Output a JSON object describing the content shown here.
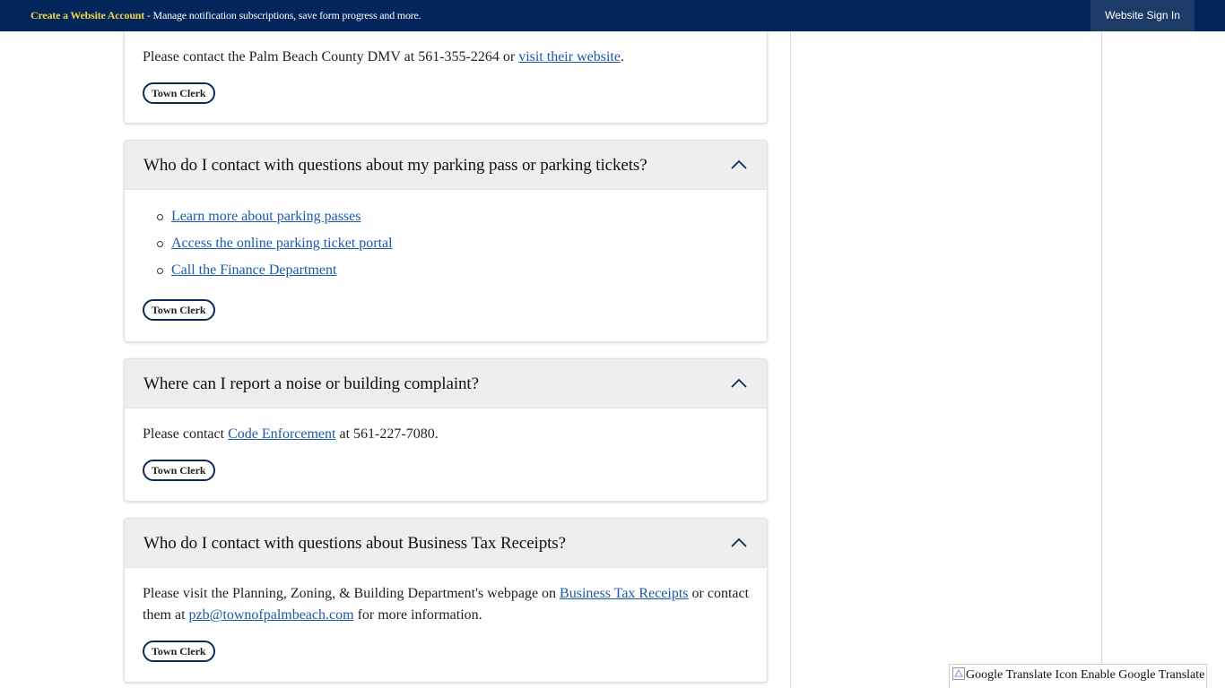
{
  "topbar": {
    "create_link": "Create a Website Account",
    "message": " - Manage notification subscriptions, save form progress and more.",
    "signin_label": "Website Sign In"
  },
  "card_dmv": {
    "text_before": "Please contact the Palm Beach County DMV at 561-355-2264 or ",
    "link": "visit their website",
    "text_after": ".",
    "tag": "Town Clerk"
  },
  "card_parking": {
    "title": "Who do I contact with questions about my parking pass or parking tickets?",
    "links": [
      "Learn more about parking passes",
      "Access the online parking ticket portal",
      "Call the Finance Department"
    ],
    "tag": "Town Clerk"
  },
  "card_noise": {
    "title": "Where can I report a noise or building complaint?",
    "text_before": "Please contact ",
    "link": "Code Enforcement",
    "text_after": " at 561-227-7080.",
    "tag": "Town Clerk"
  },
  "card_btr": {
    "title": "Who do I contact with questions about Business Tax Receipts?",
    "text_1": "Please visit the Planning, Zoning, & Building Department's webpage on ",
    "link_1": "Business Tax Receipts",
    "text_2": " or contact them at ",
    "link_2": "pzb@townofpalmbeach.com",
    "text_3": " for more information.",
    "tag": "Town Clerk"
  },
  "translate": {
    "icon_alt": "Google Translate Icon",
    "label": " Enable Google Translate"
  },
  "colors": {
    "topbar_bg": "#02265a",
    "create_link": "#f2d24b",
    "link": "#1a5aa6",
    "tag_border": "#0b2a55"
  },
  "icons": [
    "chevron-up-icon",
    "google-translate-icon"
  ]
}
